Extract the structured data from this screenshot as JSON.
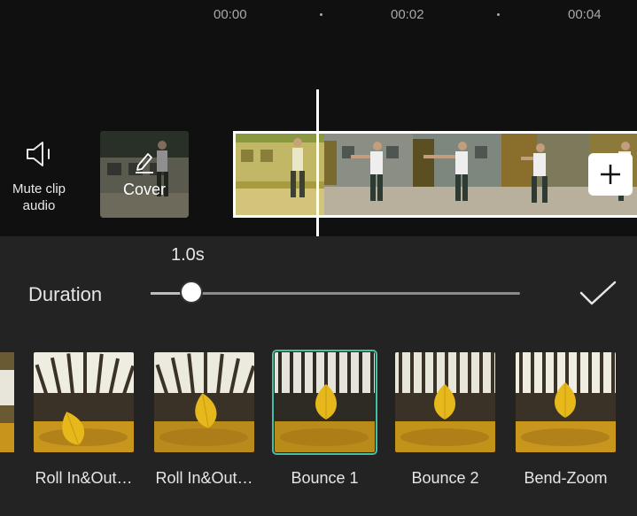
{
  "timeline": {
    "ruler": [
      "00:00",
      "00:02",
      "00:04"
    ]
  },
  "mute": {
    "label": "Mute clip\naudio",
    "icon": "speaker-icon"
  },
  "cover": {
    "label": "Cover",
    "icon": "pencil-icon"
  },
  "track": {
    "frames": 5
  },
  "add_button": {
    "icon": "plus-icon"
  },
  "duration": {
    "label": "Duration",
    "value": "1.0s",
    "slider_fraction": 0.11
  },
  "confirm": {
    "icon": "checkmark-icon"
  },
  "effects": [
    {
      "label": "Roll In&Out…"
    },
    {
      "label": "Roll In&Out…"
    },
    {
      "label": "Bounce 1",
      "selected": true
    },
    {
      "label": "Bounce 2"
    },
    {
      "label": "Bend-Zoom"
    }
  ],
  "colors": {
    "background": "#101010",
    "panel": "#232323",
    "selected_outline": "#44c0a6"
  }
}
